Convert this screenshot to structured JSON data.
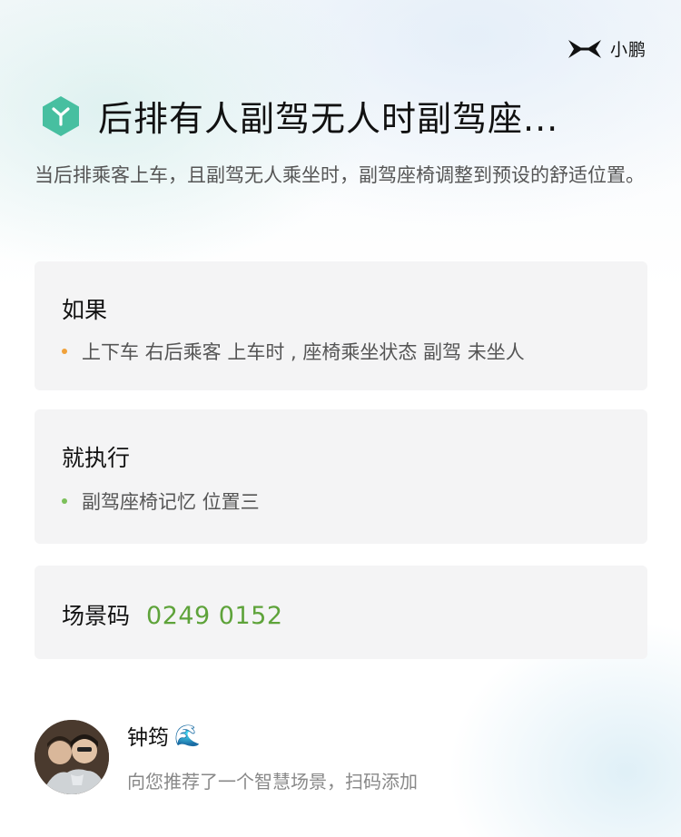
{
  "brand": {
    "name": "小鹏",
    "logo_icon": "xpeng-logo-icon"
  },
  "header": {
    "icon": "scene-cube-icon",
    "title": "后排有人副驾无人时副驾座...",
    "description": "当后排乘客上车，且副驾无人乘坐时，副驾座椅调整到预设的舒适位置。"
  },
  "condition": {
    "title": "如果",
    "item": "上下车 右后乘客 上车时 , 座椅乘坐状态 副驾 未坐人",
    "dot_color": "#f0a13a"
  },
  "action": {
    "title": "就执行",
    "item": "副驾座椅记忆 位置三",
    "dot_color": "#7cc05a"
  },
  "scene_code": {
    "label": "场景码",
    "value": "0249 0152",
    "color": "#5ea33a"
  },
  "user": {
    "name": "钟筠",
    "emoji": "🌊",
    "subtitle": "向您推荐了一个智慧场景，扫码添加"
  }
}
